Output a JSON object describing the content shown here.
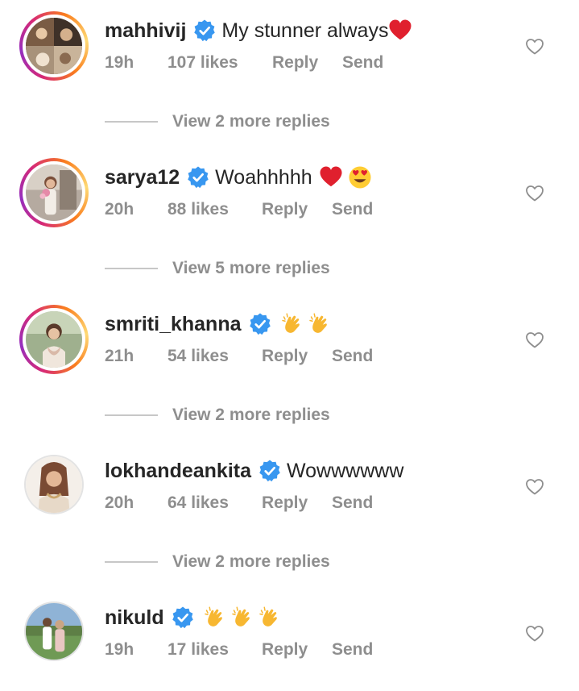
{
  "comments": [
    {
      "username": "mahhivij",
      "verified": true,
      "text": "My stunner always",
      "emojis": [
        "red-heart"
      ],
      "time": "19h",
      "likes": "107 likes",
      "reply": "Reply",
      "send": "Send",
      "story_ring": true,
      "more_replies": "View 2 more replies"
    },
    {
      "username": "sarya12",
      "verified": true,
      "text": "Woahhhhh",
      "emojis": [
        "red-heart",
        "heart-eyes"
      ],
      "time": "20h",
      "likes": "88 likes",
      "reply": "Reply",
      "send": "Send",
      "story_ring": true,
      "more_replies": "View 5 more replies"
    },
    {
      "username": "smriti_khanna",
      "verified": true,
      "text": "",
      "emojis": [
        "clapping-hands",
        "clapping-hands"
      ],
      "time": "21h",
      "likes": "54 likes",
      "reply": "Reply",
      "send": "Send",
      "story_ring": true,
      "more_replies": "View 2 more replies"
    },
    {
      "username": "lokhandeankita",
      "verified": true,
      "text": "Wowwwwww",
      "emojis": [],
      "time": "20h",
      "likes": "64 likes",
      "reply": "Reply",
      "send": "Send",
      "story_ring": false,
      "more_replies": "View 2 more replies"
    },
    {
      "username": "nikuld",
      "verified": true,
      "text": "",
      "emojis": [
        "clapping-hands",
        "clapping-hands",
        "clapping-hands"
      ],
      "time": "19h",
      "likes": "17 likes",
      "reply": "Reply",
      "send": "Send",
      "story_ring": false
    }
  ],
  "colors": {
    "verified_badge": "#3897f0",
    "secondary_text": "#8e8e8e",
    "primary_text": "#262626",
    "heart_emoji": "#e0202e"
  },
  "icons": {
    "verified": "verified-badge-icon",
    "like": "heart-outline-icon"
  }
}
